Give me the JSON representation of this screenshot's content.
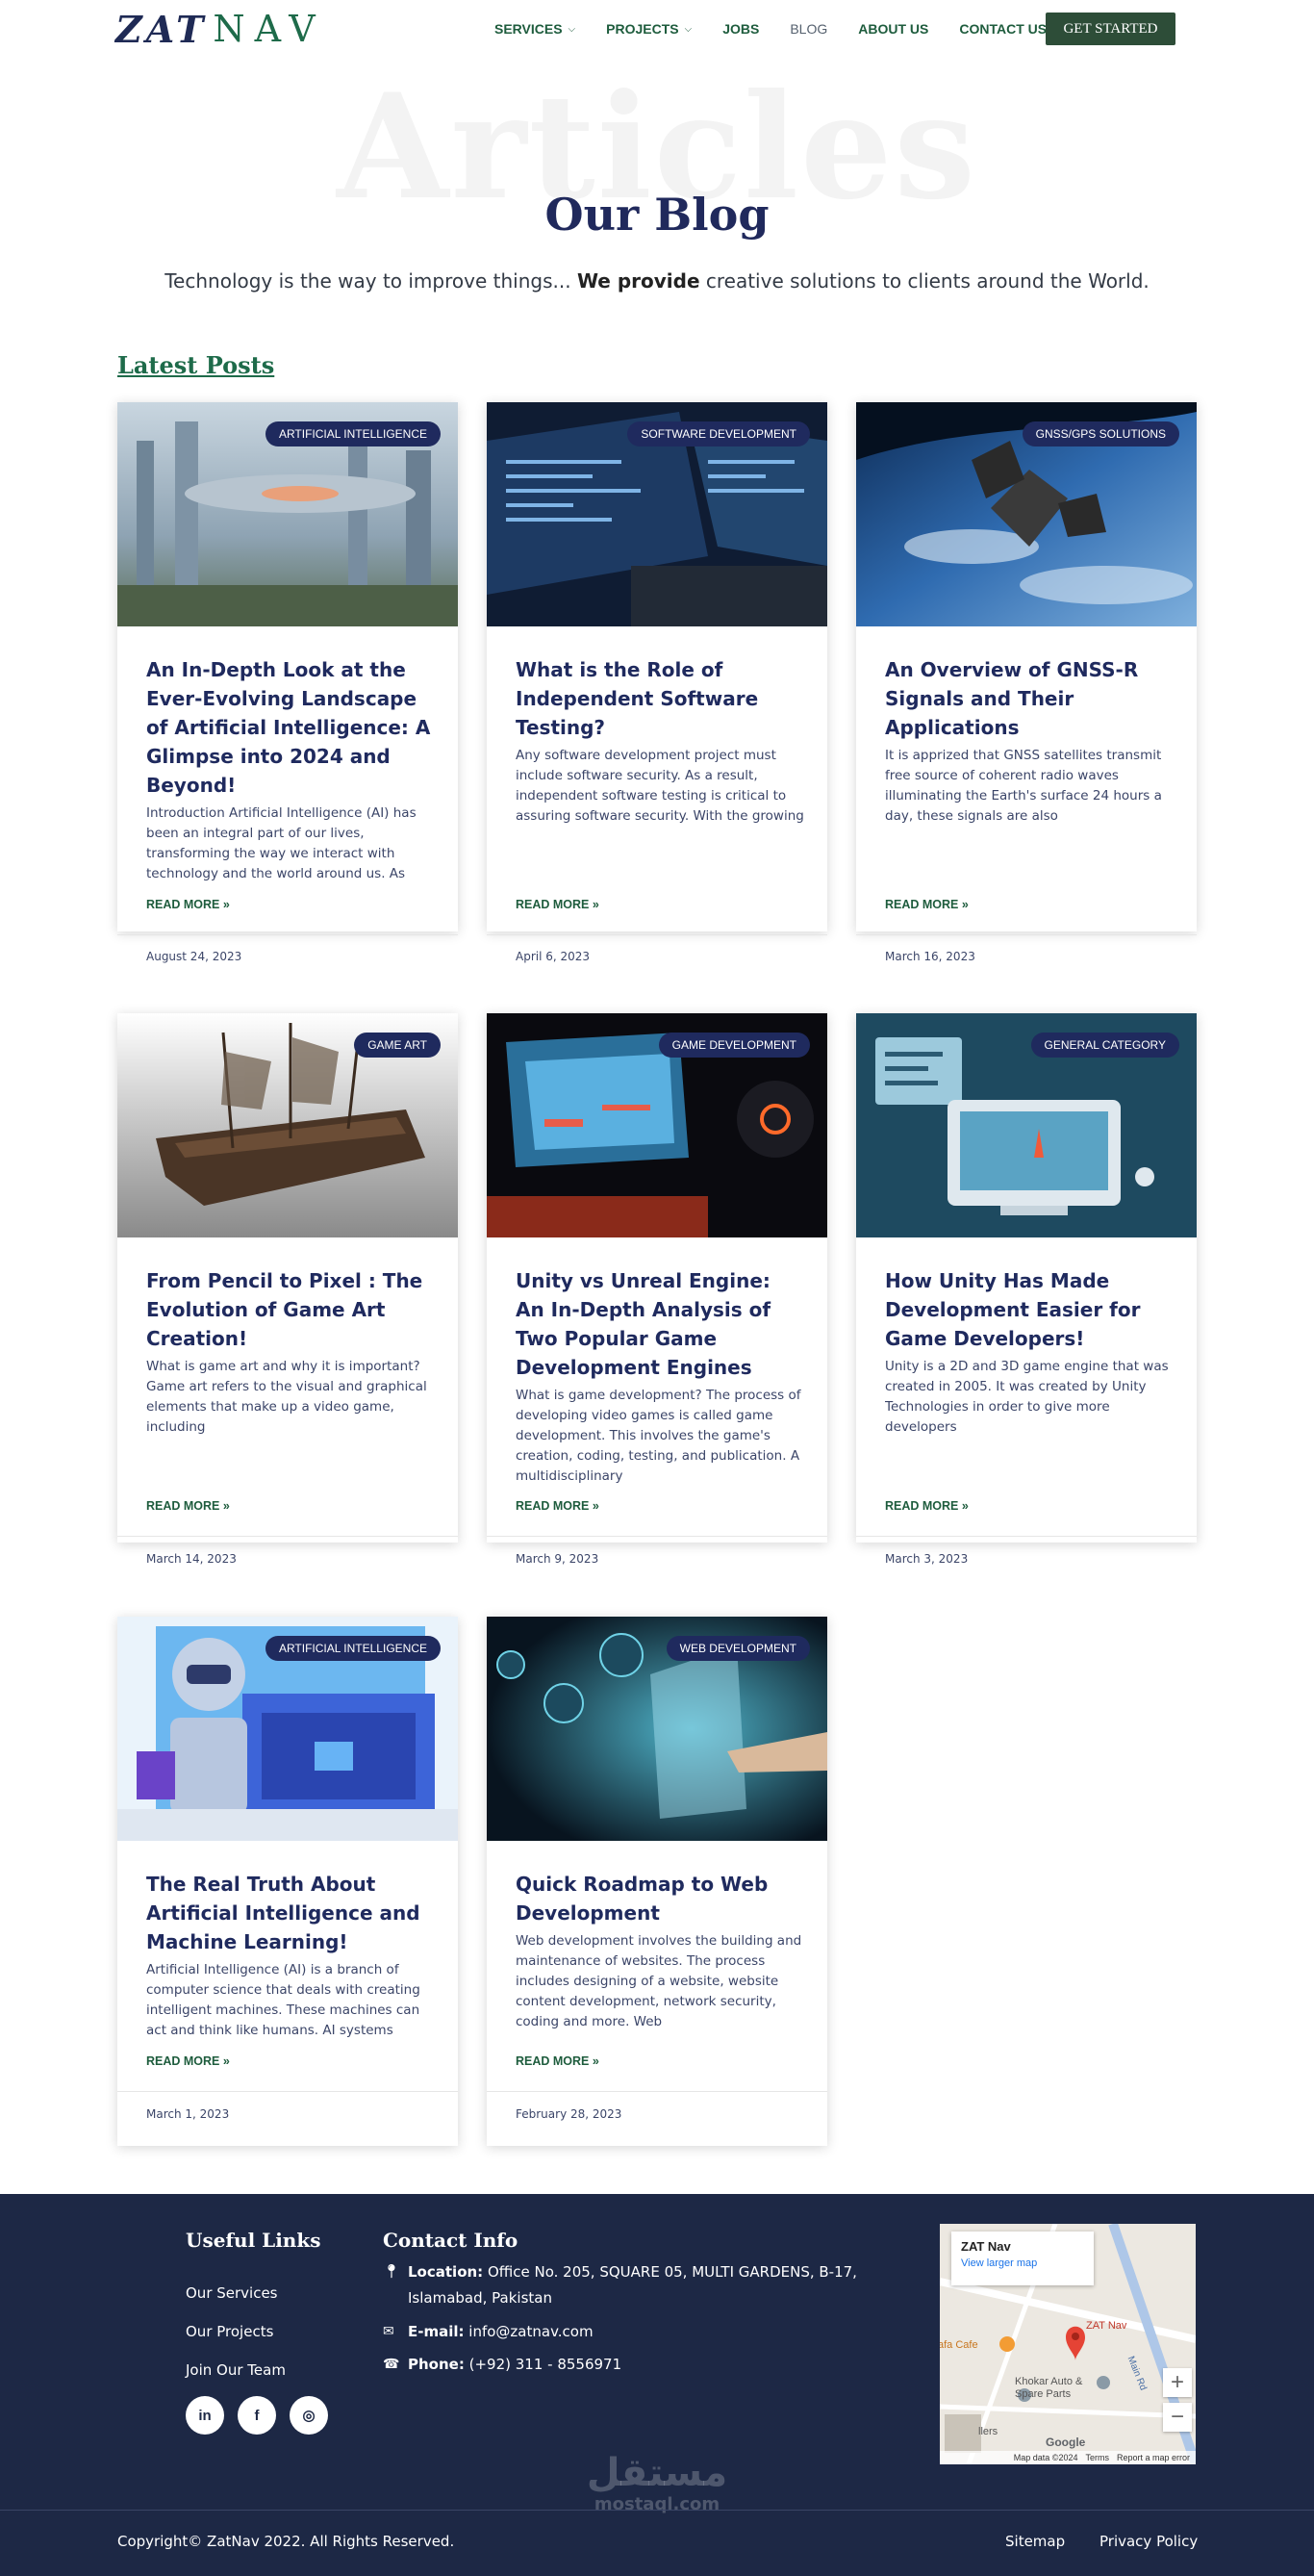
{
  "header": {
    "logo_main": "ZAT",
    "logo_sub": "NAV",
    "menu": [
      {
        "label": "SERVICES",
        "has_dropdown": true
      },
      {
        "label": "PROJECTS",
        "has_dropdown": true
      },
      {
        "label": "JOBS",
        "has_dropdown": false
      },
      {
        "label": "BLOG",
        "has_dropdown": false
      },
      {
        "label": "ABOUT US",
        "has_dropdown": false
      },
      {
        "label": "CONTACT US",
        "has_dropdown": false
      }
    ],
    "cta": "GET STARTED"
  },
  "hero": {
    "background_word": "Articles",
    "title": "Our Blog",
    "tagline_pre": "Technology is the way to improve things... ",
    "tagline_bold": "We provide",
    "tagline_post": " creative solutions to clients around the World."
  },
  "latest_heading": "Latest Posts",
  "posts": [
    {
      "category": "ARTIFICIAL INTELLIGENCE",
      "title": "An In-Depth Look at the Ever-Evolving Landscape of Artificial Intelligence: A Glimpse into 2024 and Beyond!",
      "excerpt": "Introduction Artificial Intelligence (AI) has been an integral part of our lives, transforming the way we interact with technology and the world around us. As",
      "read_more": "READ MORE »",
      "date": "August 24, 2023",
      "image": "futuristic-city"
    },
    {
      "category": "SOFTWARE DEVELOPMENT",
      "title": "What is the Role of Independent Software Testing?",
      "excerpt": "Any software development project must include software security. As a result, independent software testing is critical to assuring software security. With the growing number of",
      "read_more": "READ MORE »",
      "date": "April 6, 2023",
      "image": "code-screens"
    },
    {
      "category": "GNSS/GPS SOLUTIONS",
      "title": "An Overview of GNSS-R Signals and Their Applications",
      "excerpt": "It is apprized that GNSS satellites transmit free source of coherent radio waves illuminating the Earth's surface 24 hours a day, these signals are also",
      "read_more": "READ MORE »",
      "date": "March 16, 2023",
      "image": "satellite-earth"
    },
    {
      "category": "GAME ART",
      "title": "From Pencil to Pixel : The Evolution of Game Art Creation!",
      "excerpt": "What is game art and why it is important? Game art refers to the visual and graphical elements that make up a video game, including",
      "read_more": "READ MORE »",
      "date": "March 14, 2023",
      "image": "pirate-ship"
    },
    {
      "category": "GAME DEVELOPMENT",
      "title": "Unity vs Unreal Engine: An In-Depth Analysis of Two Popular Game Development Engines",
      "excerpt": "What is game development? The process of developing video games is called game development. This involves the game's creation, coding, testing, and publication. A multidisciplinary",
      "read_more": "READ MORE »",
      "date": "March 9, 2023",
      "image": "gaming-setup"
    },
    {
      "category": "GENERAL CATEGORY",
      "title": "How Unity Has Made Development Easier for Game Developers!",
      "excerpt": "Unity is a 2D and 3D game engine that was created in 2005. It was created by Unity Technologies in order to give more developers",
      "read_more": "READ MORE »",
      "date": "March 3, 2023",
      "image": "laptop-illustration"
    },
    {
      "category": "ARTIFICIAL INTELLIGENCE",
      "title": "The Real Truth About Artificial Intelligence and Machine Learning!",
      "excerpt": "Artificial Intelligence (AI) is a branch of computer science that deals with creating intelligent machines. These machines can act and think like humans. AI systems",
      "read_more": "READ MORE »",
      "date": "March 1, 2023",
      "image": "robot-illustration"
    },
    {
      "category": "WEB DEVELOPMENT",
      "title": "Quick Roadmap to Web Development",
      "excerpt": "Web development involves the building and maintenance of websites. The process includes designing of a website, website content development, network security, coding and more. Web",
      "read_more": "READ MORE »",
      "date": "February 28, 2023",
      "image": "web-dev-hand"
    }
  ],
  "footer": {
    "useful_links_heading": "Useful Links",
    "useful_links": [
      "Our Services",
      "Our Projects",
      "Join Our Team"
    ],
    "social": [
      {
        "icon": "linkedin-icon",
        "glyph": "in"
      },
      {
        "icon": "facebook-icon",
        "glyph": "f"
      },
      {
        "icon": "instagram-icon",
        "glyph": "◎"
      }
    ],
    "contact_heading": "Contact Info",
    "location_label": "Location:",
    "location_value": "Office No. 205, SQUARE 05, MULTI GARDENS, B-17, Islamabad, Pakistan",
    "email_label": "E-mail:",
    "email_value": "info@zatnav.com",
    "phone_label": "Phone:",
    "phone_value": "(+92) 311 - 8556971",
    "map": {
      "place_name": "ZAT Nav",
      "larger_map": "View larger map",
      "pin_label": "ZAT Nav",
      "poi_1": "afa Cafe",
      "poi_2": "Khokar Auto & Spare Parts",
      "poi_3": "llers",
      "road": "Main Rd",
      "google": "Google",
      "attribution": "Map data ©2024",
      "terms": "Terms",
      "report": "Report a map error",
      "zoom_in": "+",
      "zoom_out": "−"
    },
    "copyright": "Copyright© ZatNav 2022. All Rights Reserved.",
    "bottom_links": [
      "Sitemap",
      "Privacy Policy"
    ],
    "watermark_ar": "مستقل",
    "watermark_en": "mostaql.com"
  },
  "colors": {
    "navy": "#1f2a5e",
    "green": "#1e5c3d",
    "footer_bg": "#1d2845",
    "cta_bg": "#2d4d38"
  }
}
